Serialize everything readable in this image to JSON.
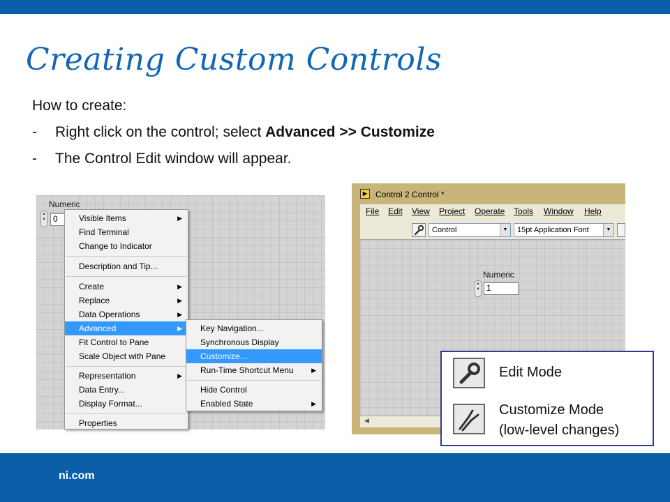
{
  "slide": {
    "title": "Creating Custom Controls",
    "intro": "How to create:",
    "bullets": [
      {
        "dash": "-",
        "before": "Right click on the control; select ",
        "bold": "Advanced >> Customize"
      },
      {
        "dash": "-",
        "before": "The Control Edit window will appear.",
        "bold": ""
      }
    ],
    "footer": "ni.com"
  },
  "context_shot": {
    "control_label": "Numeric",
    "control_value": "0",
    "menu_items": [
      "Visible Items",
      "Find Terminal",
      "Change to Indicator",
      "Description and Tip...",
      "Create",
      "Replace",
      "Data Operations",
      "Advanced",
      "Fit Control to Pane",
      "Scale Object with Pane",
      "Representation",
      "Data Entry...",
      "Display Format...",
      "Properties"
    ],
    "submenu_items": [
      "Key Navigation...",
      "Synchronous Display",
      "Customize...",
      "Run-Time Shortcut Menu",
      "Hide Control",
      "Enabled State"
    ]
  },
  "edit_window": {
    "title": "Control 2 Control *",
    "menus": [
      "File",
      "Edit",
      "View",
      "Project",
      "Operate",
      "Tools",
      "Window",
      "Help"
    ],
    "mode_select": "Control",
    "font_select": "15pt Application Font",
    "control_label": "Numeric",
    "control_value": "1"
  },
  "legend": {
    "edit_mode": "Edit Mode",
    "customize_mode_line1": "Customize Mode",
    "customize_mode_line2": "(low-level changes)"
  },
  "colors": {
    "brand_blue": "#0b5fa8",
    "title_blue": "#1466b3",
    "menu_highlight": "#3399ff"
  }
}
